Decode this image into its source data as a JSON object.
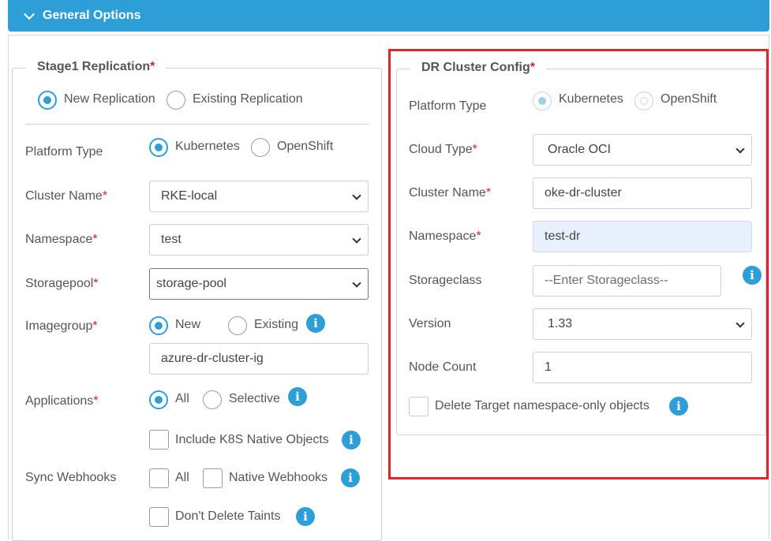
{
  "header": {
    "title": "General Options"
  },
  "stage1": {
    "legend": "Stage1 Replication",
    "replication_options": [
      "New Replication",
      "Existing Replication"
    ],
    "platform_label": "Platform Type",
    "platform_options": [
      "Kubernetes",
      "OpenShift"
    ],
    "cluster_label": "Cluster Name",
    "cluster_value": "RKE-local",
    "namespace_label": "Namespace",
    "namespace_value": "test",
    "storagepool_label": "Storagepool",
    "storagepool_value": "storage-pool",
    "imagegroup_label": "Imagegroup",
    "imagegroup_options": [
      "New",
      "Existing"
    ],
    "imagegroup_value": "azure-dr-cluster-ig",
    "applications_label": "Applications",
    "applications_options": [
      "All",
      "Selective"
    ],
    "include_k8s_label": "Include K8S Native Objects",
    "sync_webhooks_label": "Sync Webhooks",
    "webhook_all_label": "All",
    "native_webhooks_label": "Native Webhooks",
    "dont_delete_taints_label": "Don't Delete Taints"
  },
  "dr": {
    "legend": "DR Cluster Config",
    "platform_label": "Platform Type",
    "platform_options": [
      "Kubernetes",
      "OpenShift"
    ],
    "cloud_label": "Cloud Type",
    "cloud_value": "Oracle OCI",
    "cluster_label": "Cluster Name",
    "cluster_value": "oke-dr-cluster",
    "namespace_label": "Namespace",
    "namespace_value": "test-dr",
    "storageclass_label": "Storageclass",
    "storageclass_placeholder": "--Enter Storageclass--",
    "version_label": "Version",
    "version_value": "1.33",
    "node_count_label": "Node Count",
    "node_count_value": "1",
    "delete_target_label": "Delete Target namespace-only objects"
  },
  "required_mark": "*",
  "info_glyph": "i",
  "colors": {
    "accent": "#2e9fd6",
    "required": "#d9232d",
    "highlight": "#e0242b",
    "autofill": "#e8f0fe"
  }
}
